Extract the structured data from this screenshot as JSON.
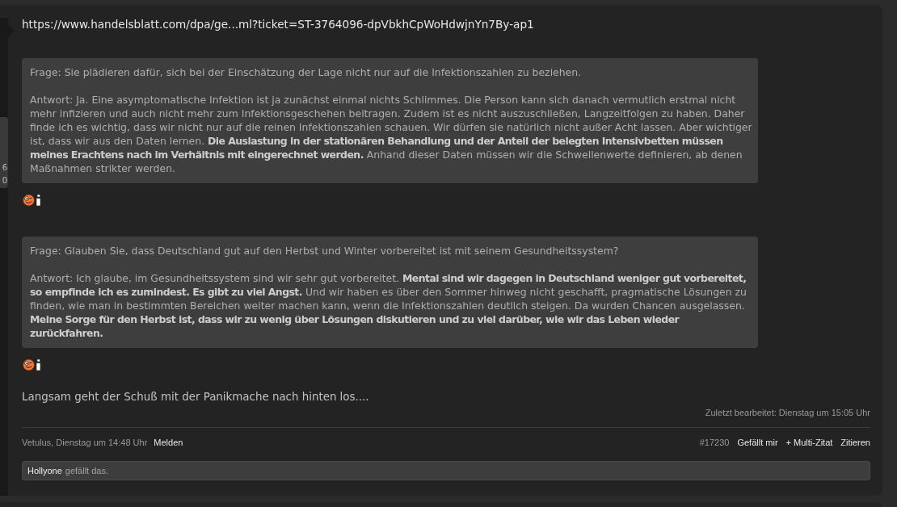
{
  "sidebar": {
    "lines": [
      "6",
      "0"
    ]
  },
  "post": {
    "blocks": [
      {
        "kind": "link",
        "text": "https://www.handelsblatt.com/dpa/ge...ml?ticket=ST-3764096-dpVbkhCpWoHdwjnYn7By-ap1"
      },
      {
        "kind": "quote",
        "question": "Frage: Sie plädieren dafür, sich bei der Einschätzung der Lage nicht nur auf die Infektionszahlen zu beziehen.",
        "answer": "Antwort: Ja. Eine asymptomatische Infektion ist ja zunächst einmal nichts Schlimmes. Die Person kann sich danach vermutlich erstmal nicht mehr infizieren und auch nicht mehr zum Infektionsgeschehen beitragen. Zudem ist es nicht auszuschließen, Langzeitfolgen zu haben. Daher finde ich es wichtig, dass wir nicht nur auf die reinen Infektionszahlen schauen. Wir dürfen sie natürlich nicht außer Acht lassen. Aber wichtiger ist, dass wir aus den Daten lernen. **Die Auslastung in der stationären Behandlung und der Anteil der belegten Intensivbetten müssen meines Erachtens nach im Verhältnis mit eingerechnet werden.** Anhand dieser Daten müssen wir die Schwellenwerte definieren, ab denen Maßnahmen strikter werden."
      },
      {
        "kind": "emoticon"
      },
      {
        "kind": "quote",
        "question": "Frage: Glauben Sie, dass Deutschland gut auf den Herbst und Winter vorbereitet ist mit seinem Gesundheitssystem?",
        "answer": "Antwort: Ich glaube, im Gesundheitssystem sind wir sehr gut vorbereitet. **Mental sind wir dagegen in Deutschland weniger gut vorbereitet, so empfinde ich es zumindest. Es gibt zu viel Angst.** Und wir haben es über den Sommer hinweg nicht geschafft, pragmatische Lösungen zu finden, wie man in bestimmten Bereichen weiter machen kann, wenn die Infektionszahlen deutlich steigen. Da wurden Chancen ausgelassen. **Meine Sorge für den Herbst ist, dass wir zu wenig über Lösungen diskutieren und zu viel darüber, wie wir das Leben wieder zurückfahren.**"
      },
      {
        "kind": "emoticon"
      },
      {
        "kind": "text",
        "text": "Langsam geht der Schuß mit der Panikmache nach hinten los...."
      }
    ],
    "edited": "Zuletzt bearbeitet: Dienstag um 15:05 Uhr",
    "footer": {
      "author_date": "Vetulus, Dienstag um 14:48 Uhr",
      "left_links": [
        "Melden"
      ],
      "post_number": "#17230",
      "right_links": [
        "Gefällt mir",
        "+ Multi-Zitat",
        "Zitieren"
      ]
    },
    "likes": {
      "user": "Hollyone",
      "text": "gefällt das."
    }
  }
}
